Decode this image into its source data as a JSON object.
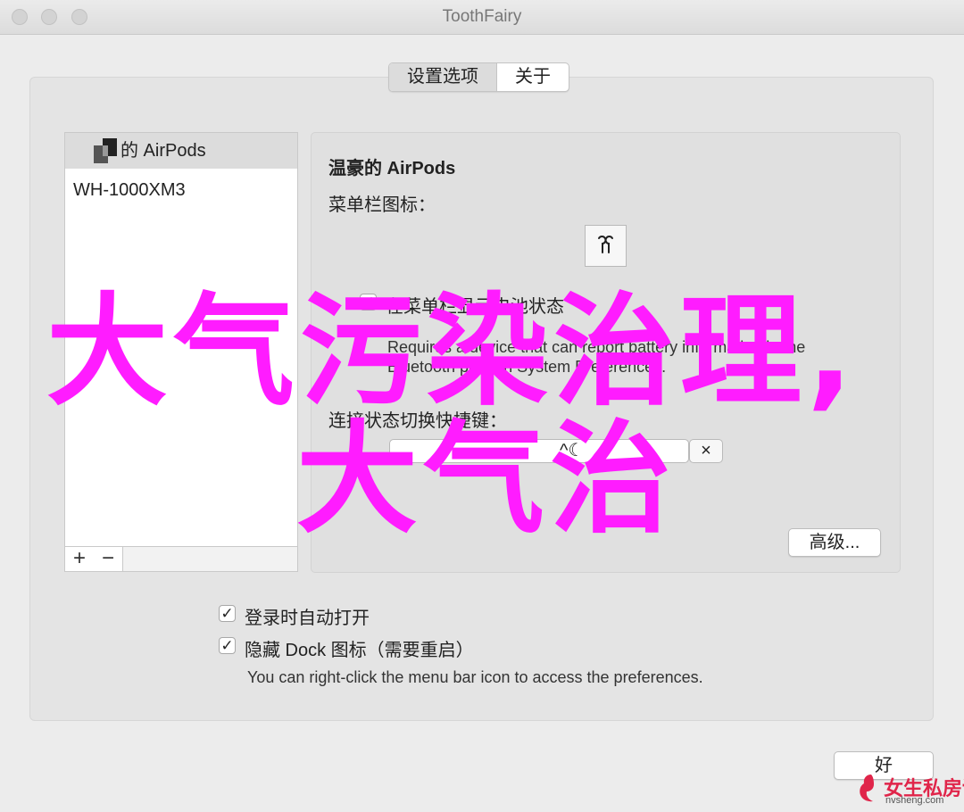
{
  "window": {
    "title": "ToothFairy"
  },
  "tabs": [
    {
      "label": "设置选项",
      "active": true
    },
    {
      "label": "关于",
      "active": false
    }
  ],
  "devices": [
    {
      "name": "的 AirPods",
      "selected": true
    },
    {
      "name": "WH-1000XM3",
      "selected": false
    }
  ],
  "list_tools": {
    "add": "+",
    "remove": "−"
  },
  "detail": {
    "title": "温豪的 AirPods",
    "menubar_icon_label": "菜单栏图标：",
    "battery_checkbox_label": "在菜单栏显示电池状态",
    "battery_checked": true,
    "battery_note_line1": "Requires a device that can report battery information in the",
    "battery_note_line2": "Bluetooth pane in System Preferences.",
    "shortcut_label": "连接状态切换快捷键：",
    "shortcut_value": "^☾",
    "clear_button": "×",
    "advanced_button": "高级..."
  },
  "general": {
    "open_at_login": "登录时自动打开",
    "open_at_login_checked": true,
    "hide_dock": "隐藏 Dock 图标（需要重启）",
    "hide_dock_checked": true,
    "hint": "You can right-click the menu bar icon to access the preferences."
  },
  "footer": {
    "ok_button": "好"
  },
  "watermark": {
    "line1": "大气污染治理,",
    "line2": "大气治"
  },
  "logo": {
    "text": "女生私房话",
    "url": "nvsheng.com"
  },
  "colors": {
    "watermark": "#ff1cff",
    "selection": "#dcdcdc",
    "logo": "#e0254a"
  }
}
